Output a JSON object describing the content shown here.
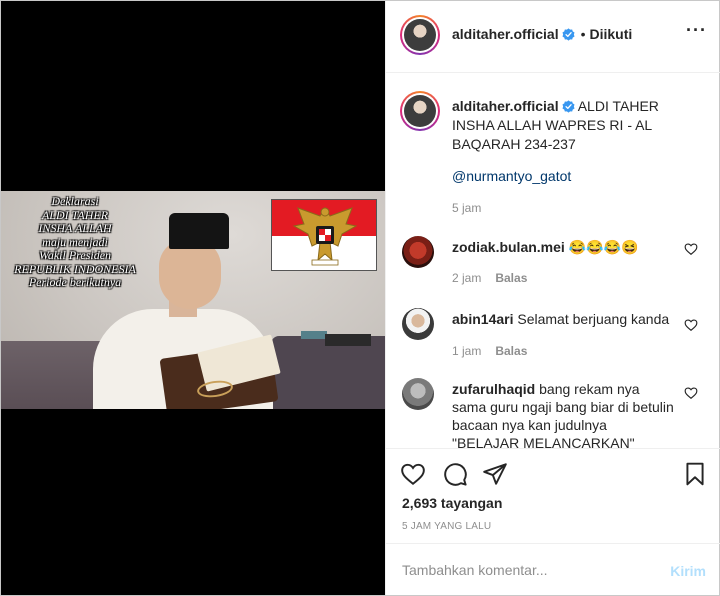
{
  "post": {
    "username": "alditaher.official",
    "follow_status": "Diikuti",
    "more_icon": "more-options-icon",
    "video_overlay": {
      "lines": [
        "Deklarasi",
        "ALDI TAHER",
        "INSHA ALLAH",
        "maju menjadi",
        "Wakil Presiden",
        "REPUBLIK INDONESIA",
        "Periode  berikutnya"
      ]
    },
    "caption": {
      "username": "alditaher.official",
      "text": "ALDI TAHER INSHA ALLAH WAPRES RI - AL BAQARAH 234-237",
      "mention": "@nurmantyo_gatot",
      "time": "5 jam"
    },
    "comments": [
      {
        "username": "zodiak.bulan.mei",
        "text": "😂😂😂😆",
        "time": "2 jam",
        "reply": "Balas"
      },
      {
        "username": "abin14ari",
        "text": "Selamat berjuang kanda",
        "time": "1 jam",
        "reply": "Balas"
      },
      {
        "username": "zufarulhaqid",
        "text": "bang rekam nya sama guru ngaji bang biar di betulin bacaan nya kan judulnya \"BELAJAR MELANCARKAN\"",
        "time": "",
        "reply": ""
      }
    ],
    "views": "2,693 tayangan",
    "posted_ago": "5 JAM YANG LALU",
    "add_comment": {
      "placeholder": "Tambahkan komentar...",
      "post_label": "Kirim"
    },
    "colors": {
      "link": "#00376b",
      "verified": "#3897f0",
      "muted": "#8e8e8e",
      "post_button": "#b2dffc"
    }
  }
}
